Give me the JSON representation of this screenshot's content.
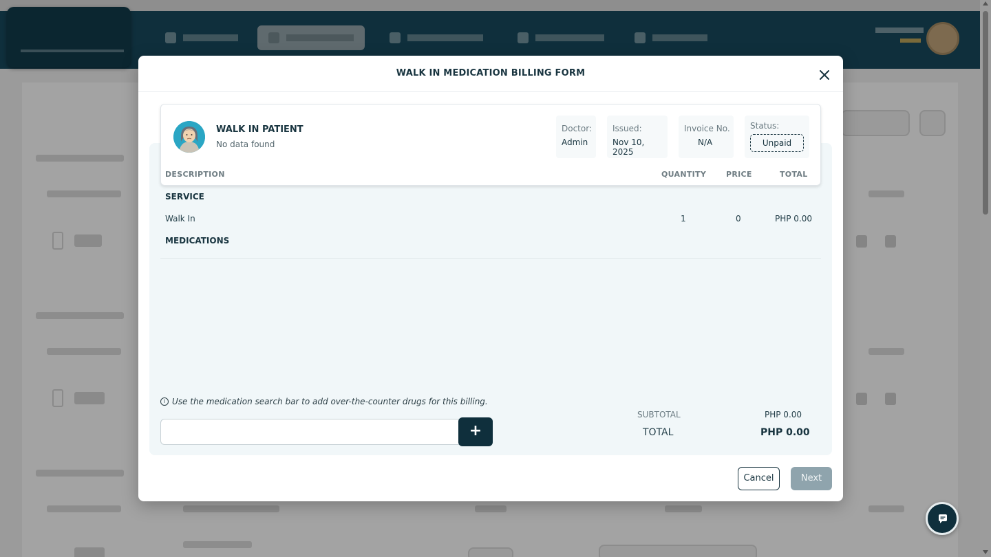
{
  "modal": {
    "title": "WALK IN MEDICATION BILLING FORM"
  },
  "patient": {
    "name": "WALK IN PATIENT",
    "subtitle": "No data found"
  },
  "meta": {
    "doctor_label": "Doctor:",
    "doctor_value": "Admin",
    "issued_label": "Issued:",
    "issued_value": "Nov 10, 2025",
    "invoice_label": "Invoice No.",
    "invoice_value": "N/A",
    "status_label": "Status:",
    "status_value": "Unpaid"
  },
  "table": {
    "headers": {
      "description": "DESCRIPTION",
      "quantity": "QUANTITY",
      "price": "PRICE",
      "total": "TOTAL"
    },
    "service_label": "SERVICE",
    "service_row": {
      "description": "Walk In",
      "quantity": "1",
      "price": "0",
      "total": "PHP 0.00"
    },
    "medications_label": "MEDICATIONS"
  },
  "hint": "Use the medication search bar to add over-the-counter drugs for this billing.",
  "search": {
    "value": "",
    "add_label": "+"
  },
  "summary": {
    "subtotal_label": "SUBTOTAL",
    "subtotal_value": "PHP 0.00",
    "total_label": "TOTAL",
    "total_value": "PHP 0.00"
  },
  "actions": {
    "cancel": "Cancel",
    "next": "Next"
  },
  "colors": {
    "brand_dark": "#0f2f3c",
    "next_disabled": "#8fa4ad",
    "panel_bg": "#f1f7f9"
  },
  "icons": {
    "close": "close-icon",
    "info": "info-icon",
    "chat": "chat-icon",
    "patient_avatar": "avatar-icon"
  }
}
